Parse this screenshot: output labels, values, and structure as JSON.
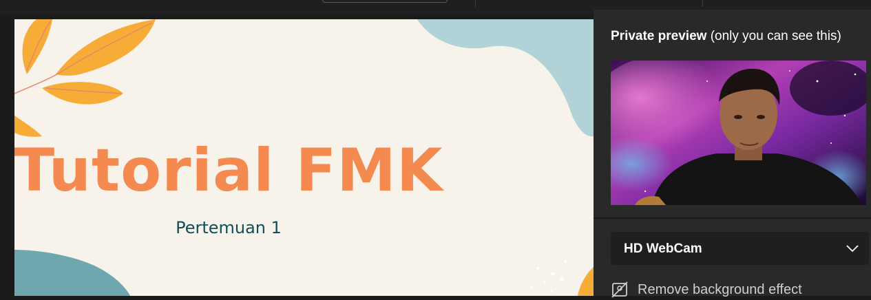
{
  "slide": {
    "title": "Tutorial FMK",
    "subtitle": "Pertemuan 1"
  },
  "preview_panel": {
    "heading_bold": "Private preview",
    "heading_rest": " (only you can see this)",
    "camera_select": {
      "selected": "HD WebCam",
      "icon": "chevron-down-icon"
    },
    "remove_background": {
      "label": "Remove background effect",
      "icon": "no-background-icon"
    }
  },
  "colors": {
    "slide_title": "#f48a4f",
    "slide_subtitle": "#0f4e5b",
    "slide_background": "#f7f2ea",
    "panel_background": "#292929"
  }
}
